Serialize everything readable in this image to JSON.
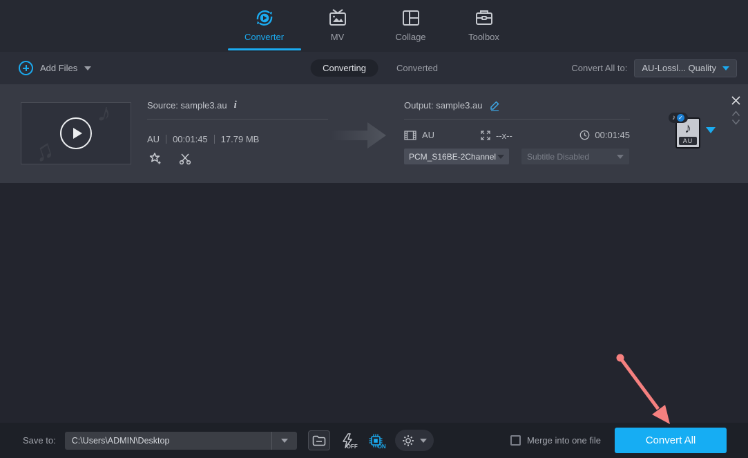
{
  "header": {
    "tabs": [
      {
        "label": "Converter"
      },
      {
        "label": "MV"
      },
      {
        "label": "Collage"
      },
      {
        "label": "Toolbox"
      }
    ]
  },
  "toolbar": {
    "add_files_label": "Add Files",
    "queue_tabs": {
      "converting": "Converting",
      "converted": "Converted"
    },
    "convert_all_to_label": "Convert All to:",
    "format_selector_value": "AU-Lossl... Quality"
  },
  "file_item": {
    "source_title": "Source: sample3.au",
    "source_format": "AU",
    "source_duration": "00:01:45",
    "source_size": "17.79 MB",
    "output_title": "Output: sample3.au",
    "output_format": "AU",
    "output_resolution": "--x--",
    "output_duration": "00:01:45",
    "audio_codec_value": "PCM_S16BE-2Channel",
    "subtitle_value": "Subtitle Disabled",
    "format_badge": "AU"
  },
  "footer": {
    "save_to_label": "Save to:",
    "save_path": "C:\\Users\\ADMIN\\Desktop",
    "speed_state": "OFF",
    "hardware_state": "ON",
    "merge_label": "Merge into one file",
    "convert_all_label": "Convert All"
  },
  "colors": {
    "accent_blue": "#1babf0",
    "convert_button": "#16adf3",
    "annotation_arrow": "#f5807f",
    "row_background": "#373a44",
    "footer_background": "#1d2027"
  },
  "glyphs": {
    "music_note": "♪",
    "music_notes_double": "♫",
    "check": "✓"
  }
}
